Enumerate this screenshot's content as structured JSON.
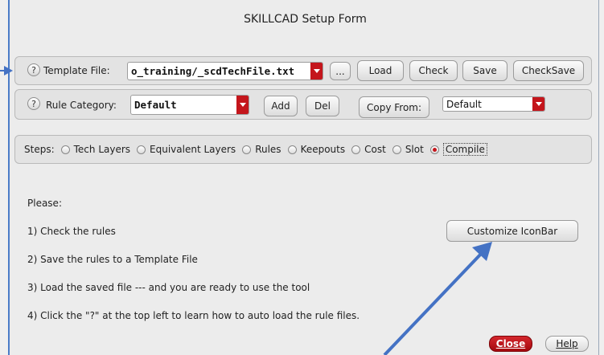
{
  "window": {
    "title": "SKILLCAD Setup Form"
  },
  "help_glyph": "?",
  "template_row": {
    "label": "Template File:",
    "value": "o_training/_scdTechFile.txt",
    "browse_label": "...",
    "load_label": "Load",
    "check_label": "Check",
    "save_label": "Save",
    "checksave_label": "CheckSave"
  },
  "category_row": {
    "label": "Rule Category:",
    "value": "Default",
    "add_label": "Add",
    "del_label": "Del",
    "copy_from_label": "Copy From:",
    "copy_from_value": "Default"
  },
  "steps": {
    "label": "Steps:",
    "options": [
      "Tech Layers",
      "Equivalent Layers",
      "Rules",
      "Keepouts",
      "Cost",
      "Slot",
      "Compile"
    ],
    "selected": "Compile"
  },
  "instructions": {
    "intro": "Please:",
    "items": [
      "1) Check the rules",
      "2) Save the rules to a Template File",
      "3) Load the saved file --- and you are ready to use the tool",
      "4) Click the \"?\" at the top left to learn how to auto load the rule files."
    ]
  },
  "customize_label": "Customize IconBar",
  "footer": {
    "close_label": "Close",
    "help_label": "Help"
  },
  "colors": {
    "accent_red": "#c4161c",
    "arrow_blue": "#4472c4"
  }
}
